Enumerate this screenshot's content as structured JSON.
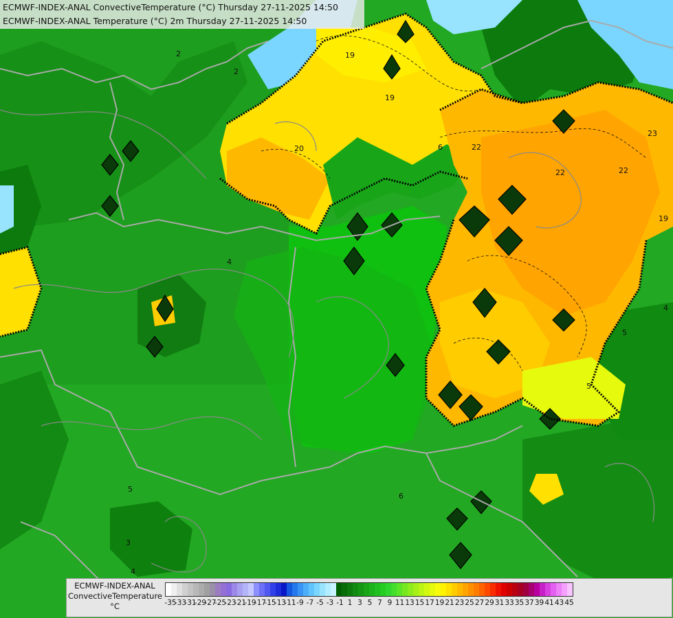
{
  "header": {
    "line1": "ECMWF-INDEX-ANAL ConvectiveTemperature (°C) Thursday 27-11-2025 14:50",
    "line2": "ECMWF-INDEX-ANAL Temperature (°C) 2m Thursday 27-11-2025 14:50"
  },
  "map": {
    "contour_labels": [
      "2",
      "2",
      "4",
      "5",
      "3",
      "4",
      "6",
      "19",
      "19",
      "20",
      "6",
      "22",
      "22",
      "23",
      "22",
      "19",
      "4",
      "5",
      "5"
    ]
  },
  "legend": {
    "title_line1": "ECMWF-INDEX-ANAL",
    "title_line2": "ConvectiveTemperature",
    "title_line3": "°C",
    "labels": [
      "-35",
      "-33",
      "-31",
      "-29",
      "-27",
      "-25",
      "-23",
      "-21",
      "-19",
      "-17",
      "-15",
      "-13",
      "-11",
      "-9",
      "-7",
      "-5",
      "-3",
      "-1",
      "1",
      "3",
      "5",
      "7",
      "9",
      "11",
      "13",
      "15",
      "17",
      "19",
      "21",
      "23",
      "25",
      "27",
      "29",
      "31",
      "33",
      "35",
      "37",
      "39",
      "41",
      "43",
      "45"
    ],
    "colors": [
      "#ffffff",
      "#f0f0f0",
      "#e0e0e0",
      "#d0d0d0",
      "#c4c4c4",
      "#b8b8b8",
      "#acacac",
      "#a0a0a0",
      "#9a90a8",
      "#9c7cc0",
      "#9470d4",
      "#8a6ae0",
      "#9c88e8",
      "#a8a0f0",
      "#b4b4f8",
      "#c4c8ff",
      "#8c90ff",
      "#6c70f8",
      "#5058f0",
      "#3040e8",
      "#1c2cd8",
      "#0818c8",
      "#1458e0",
      "#2478ec",
      "#3894f4",
      "#4caef8",
      "#62c4fc",
      "#7ad6fe",
      "#98e4ff",
      "#b2eeff",
      "#c8f4ff",
      "#006000",
      "#086c08",
      "#0c7a0c",
      "#108a10",
      "#149814",
      "#18a618",
      "#1cb41c",
      "#20c020",
      "#24cc24",
      "#30d630",
      "#44de2c",
      "#5ce426",
      "#76e820",
      "#8eec1c",
      "#a6f018",
      "#bcf414",
      "#d2f810",
      "#e6fa0e",
      "#f8fc0c",
      "#fff200",
      "#ffe000",
      "#ffcc00",
      "#ffb800",
      "#ffa400",
      "#ff9000",
      "#ff7c00",
      "#ff6400",
      "#ff4800",
      "#f82c00",
      "#ee1000",
      "#e00000",
      "#cc0000",
      "#b80010",
      "#a80020",
      "#a00040",
      "#a80070",
      "#b800a0",
      "#c820c8",
      "#d840e0",
      "#e460f0",
      "#ee80f8",
      "#f4a0fc",
      "#f8c4fe"
    ]
  }
}
